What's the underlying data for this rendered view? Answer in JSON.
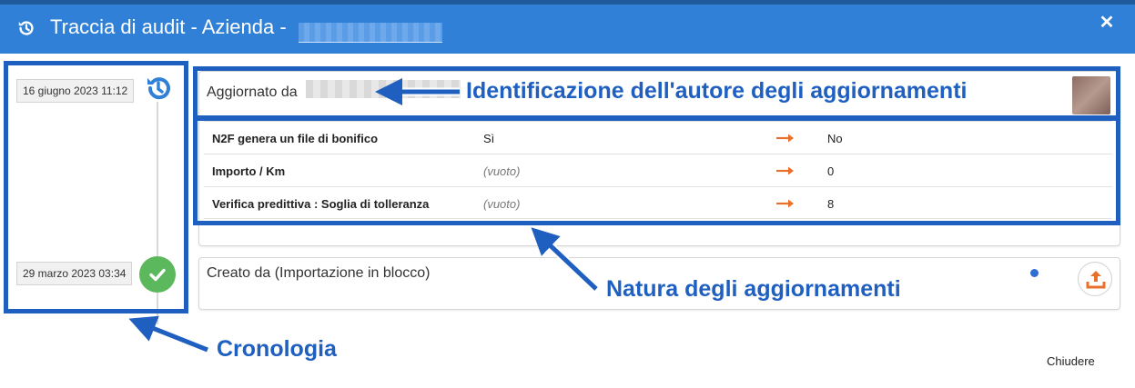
{
  "dialog": {
    "title": "Traccia di audit - Azienda -",
    "close_icon": "close-icon",
    "header_color": "#2f80d6"
  },
  "timeline": [
    {
      "date": "16 giugno 2023 11:12",
      "icon": "history-icon"
    },
    {
      "date": "29 marzo 2023 03:34",
      "icon": "check-icon"
    }
  ],
  "update_entry": {
    "label": "Aggiornato da",
    "changes": [
      {
        "field": "N2F genera un file di bonifico",
        "old": "Sì",
        "new": "No"
      },
      {
        "field": "Importo / Km",
        "old": "(vuoto)",
        "new": "0"
      },
      {
        "field": "Verifica predittiva : Soglia di tolleranza",
        "old": "(vuoto)",
        "new": "8"
      }
    ]
  },
  "create_entry": {
    "label": "Creato da (Importazione in blocco)",
    "icon": "upload-icon"
  },
  "footer": {
    "close_label": "Chiudere"
  },
  "annotations": {
    "author": "Identificazione dell'autore degli aggiornamenti",
    "nature": "Natura degli aggiornamenti",
    "timeline": "Cronologia",
    "color": "#1f5fc0"
  },
  "colors": {
    "arrow": "#e8702a",
    "check": "#5cb85c",
    "accent": "#2f80d6"
  }
}
